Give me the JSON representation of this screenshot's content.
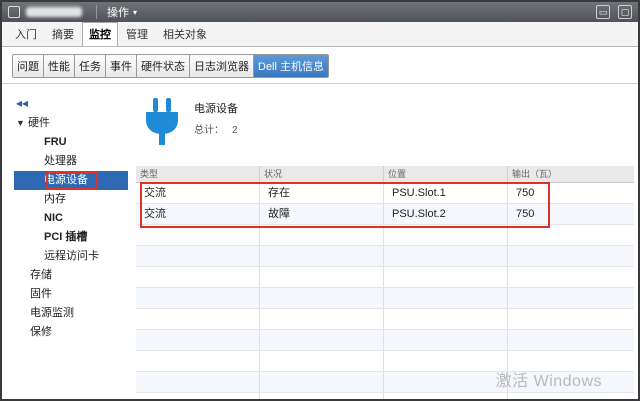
{
  "titlebar": {
    "actions_label": "操作",
    "caret": "▾"
  },
  "main_tabs": [
    {
      "label": "入门",
      "active": false
    },
    {
      "label": "摘要",
      "active": false
    },
    {
      "label": "监控",
      "active": true
    },
    {
      "label": "管理",
      "active": false
    },
    {
      "label": "相关对象",
      "active": false
    }
  ],
  "sub_tabs": [
    {
      "label": "问题",
      "active": false
    },
    {
      "label": "性能",
      "active": false
    },
    {
      "label": "任务",
      "active": false
    },
    {
      "label": "事件",
      "active": false
    },
    {
      "label": "硬件状态",
      "active": false
    },
    {
      "label": "日志浏览器",
      "active": false
    },
    {
      "label": "Dell 主机信息",
      "active": true
    }
  ],
  "sidebar": {
    "collapse_glyph": "◂◂",
    "hardware": {
      "arrow": "▼",
      "label": "硬件"
    },
    "hardware_items": [
      "FRU",
      "处理器",
      "电源设备",
      "内存",
      "NIC",
      "PCI 插槽",
      "远程访问卡"
    ],
    "top_items": [
      "存储",
      "固件",
      "电源监测",
      "保修"
    ]
  },
  "content": {
    "title": "电源设备",
    "total_label": "总计：",
    "total_value": "2",
    "columns": [
      "类型",
      "状况",
      "位置",
      "输出（瓦）"
    ],
    "rows": [
      [
        "交流",
        "存在",
        "PSU.Slot.1",
        "750"
      ],
      [
        "交流",
        "故障",
        "PSU.Slot.2",
        "750"
      ]
    ]
  },
  "watermark": "激活 Windows",
  "colors": {
    "accent": "#2e6ab4",
    "highlight_red": "#e0302a",
    "plug_blue": "#1f8ad6"
  }
}
